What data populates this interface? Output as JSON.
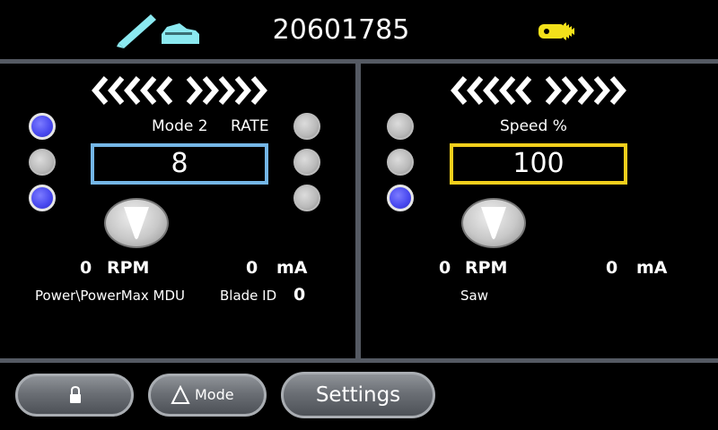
{
  "header": {
    "serial": "20601785",
    "icons": [
      "pen-icon",
      "foot-pedal-icon",
      "saw-blade-icon"
    ],
    "accent_cyan": "#8be9f0",
    "accent_yellow": "#f3e11a"
  },
  "left_panel": {
    "mode_label": "Mode 2",
    "rate_label": "RATE",
    "value": "8",
    "rpm_value": "0",
    "rpm_unit": "RPM",
    "ma_value": "0",
    "ma_unit": "mA",
    "device_name": "Power\\PowerMax MDU",
    "blade_id_label": "Blade ID",
    "blade_id_value": "0",
    "box_color": "#74b6e6"
  },
  "right_panel": {
    "speed_label": "Speed %",
    "value": "100",
    "rpm_value": "0",
    "rpm_unit": "RPM",
    "ma_value": "0",
    "ma_unit": "mA",
    "device_name": "Saw",
    "box_color": "#f3cf1c"
  },
  "footer": {
    "mode_label": "Mode",
    "settings_label": "Settings"
  }
}
